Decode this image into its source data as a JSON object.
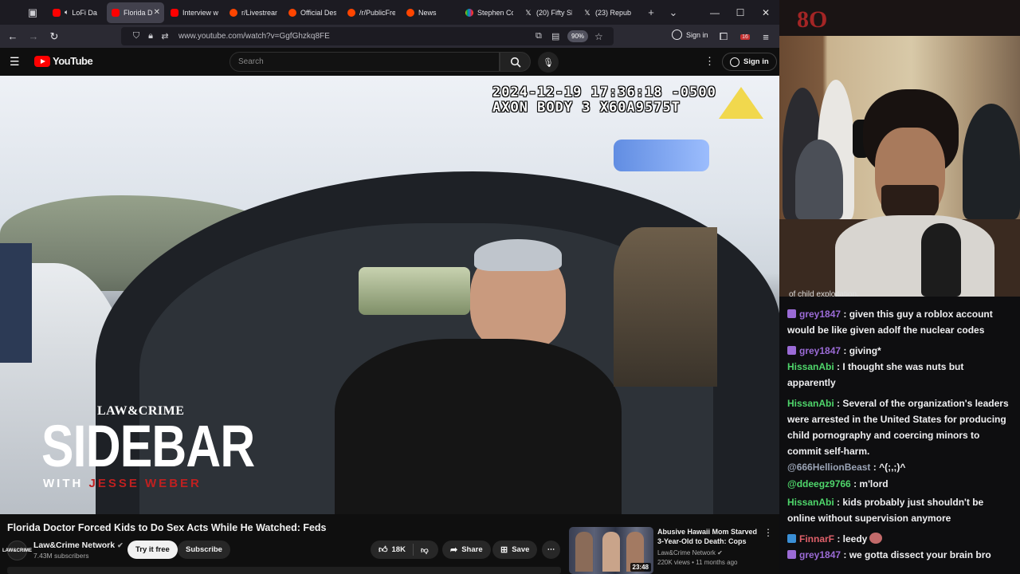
{
  "browser": {
    "tabs": [
      {
        "title": "LoFi Da",
        "favicon": "youtube",
        "active": false,
        "audio": true
      },
      {
        "title": "Florida D",
        "favicon": "youtube",
        "active": true
      },
      {
        "title": "Interview w",
        "favicon": "youtube",
        "active": false
      },
      {
        "title": "r/Livestrean",
        "favicon": "reddit",
        "active": false
      },
      {
        "title": "Official Des",
        "favicon": "reddit",
        "active": false
      },
      {
        "title": "/r/PublicFre",
        "favicon": "reddit",
        "active": false
      },
      {
        "title": "News",
        "favicon": "reddit",
        "active": false
      },
      {
        "title": "Stephen Co",
        "favicon": "nbc",
        "active": false
      },
      {
        "title": "(20) Fifty Sh",
        "favicon": "x",
        "active": false
      },
      {
        "title": "(23) Republ",
        "favicon": "x",
        "active": false
      }
    ],
    "new_tab_label": "+",
    "tab_list_label": "⌄",
    "url": "www.youtube.com/watch?v=GgfGhzkq8FE",
    "zoom": "90%",
    "signin_label": "Sign in",
    "extension_badge": "16"
  },
  "youtube": {
    "logo_text": "YouTube",
    "search_placeholder": "Search",
    "signin_label": "Sign in",
    "video": {
      "timestamp_line1": "2024-12-19 17:36:18 -0500",
      "timestamp_line2": "AXON BODY 3 X60A9575T",
      "brand_top": "LAW&CRIME",
      "brand_main": "SIDEBAR",
      "brand_with": "WITH",
      "brand_host": "JESSE WEBER"
    },
    "title": "Florida Doctor Forced Kids to Do Sex Acts While He Watched: Feds",
    "channel": {
      "name": "Law&Crime Network",
      "subscribers": "7.43M subscribers",
      "avatar_text": "LAW&CRIME"
    },
    "buttons": {
      "try_it_free": "Try it free",
      "subscribe": "Subscribe",
      "likes": "18K",
      "share": "Share",
      "save": "Save"
    },
    "recommended": {
      "title": "Abusive Hawaii Mom Starved 3-Year-Old to Death: Cops",
      "channel": "Law&Crime Network",
      "views": "220K views",
      "age": "11 months ago",
      "duration": "23:48"
    }
  },
  "stream": {
    "chat_cutoff": "of child exploitation.",
    "chat": [
      {
        "user": "grey1847",
        "color": "#9b6bd6",
        "badge": "sub",
        "text": "given this guy a roblox account would be like given adolf the nuclear codes"
      },
      {
        "user": "grey1847",
        "color": "#9b6bd6",
        "badge": "sub",
        "text": "giving*"
      },
      {
        "user": "HissanAbi",
        "color": "#4fd66b",
        "badge": "",
        "text": "I thought she was nuts but apparently"
      },
      {
        "user": "HissanAbi",
        "color": "#4fd66b",
        "badge": "",
        "text": "Several of the organization's leaders were arrested in the United States for producing child pornography and coercing minors to commit self-harm."
      },
      {
        "user": "@666HellionBeast",
        "color": "#9aa3b5",
        "badge": "",
        "text": "^(;,;)^"
      },
      {
        "user": "@ddeegz9766",
        "color": "#4fd66b",
        "badge": "",
        "text": "m'lord"
      },
      {
        "user": "HissanAbi",
        "color": "#4fd66b",
        "badge": "",
        "text": "kids probably just shouldn't be online without supervision anymore"
      },
      {
        "user": "FinnarF",
        "color": "#e0606a",
        "badge": "vip",
        "text": "leedy",
        "emote": true
      },
      {
        "user": "grey1847",
        "color": "#9b6bd6",
        "badge": "sub",
        "text": "we gotta dissect your brain bro"
      }
    ]
  }
}
